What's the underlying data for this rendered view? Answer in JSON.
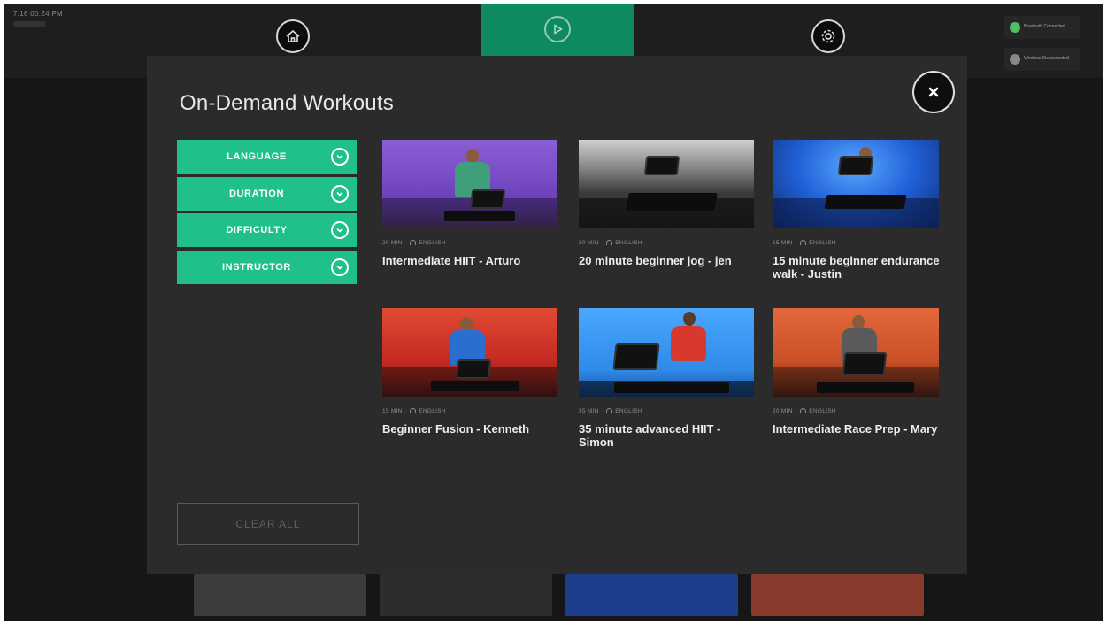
{
  "statusbar": {
    "clock": "7:16 00:24 PM"
  },
  "nav": {
    "home_icon": "home-icon",
    "play_icon": "play-icon",
    "settings_icon": "gear-icon",
    "accent": "#0d8a5e"
  },
  "status_pills": [
    {
      "text": "Bluetooth Connected",
      "color": "#4cc060"
    },
    {
      "text": "Wireless Disconnected",
      "color": "#888888"
    }
  ],
  "modal": {
    "title": "On-Demand Workouts",
    "close_label": "×",
    "clear_all_label": "CLEAR ALL",
    "filters": [
      {
        "label": "LANGUAGE"
      },
      {
        "label": "DURATION"
      },
      {
        "label": "DIFFICULTY"
      },
      {
        "label": "INSTRUCTOR"
      }
    ],
    "accent": "#1fc089",
    "workouts": [
      {
        "duration": "20 MIN",
        "language": "ENGLISH",
        "title": "Intermediate HIIT - Arturo",
        "bg": "#7b4fc8"
      },
      {
        "duration": "20 MIN",
        "language": "ENGLISH",
        "title": "20 minute beginner jog - jen",
        "bg": "#6b6b6b"
      },
      {
        "duration": "15 MIN",
        "language": "ENGLISH",
        "title": "15 minute beginner endurance walk - Justin",
        "bg": "#1f63d6"
      },
      {
        "duration": "15 MIN",
        "language": "ENGLISH",
        "title": "Beginner Fusion - Kenneth",
        "bg": "#d7352a"
      },
      {
        "duration": "35 MIN",
        "language": "ENGLISH",
        "title": "35 minute advanced HIIT - Simon",
        "bg": "#2e8fe6"
      },
      {
        "duration": "20 MIN",
        "language": "ENGLISH",
        "title": "Intermediate Race Prep - Mary",
        "bg": "#d4572b"
      }
    ]
  }
}
